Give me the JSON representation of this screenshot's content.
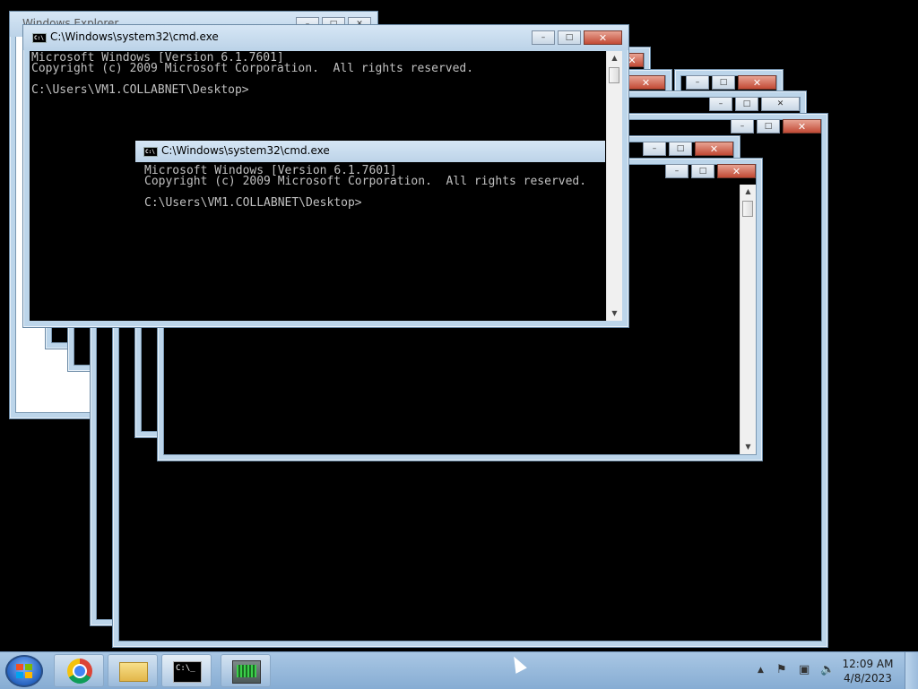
{
  "windows": [
    {
      "title": "Windows Explorer"
    },
    {
      "title": "C:\\Windows\\system32\\cmd.exe"
    },
    {
      "title": "C:\\Windows\\system32\\cmd.exe"
    }
  ],
  "console": {
    "line1": "Microsoft Windows [Version 6.1.7601]",
    "line2": "Copyright (c) 2009 Microsoft Corporation.  All rights reserved.",
    "line3": "",
    "line4": "C:\\Users\\VM1.COLLABNET\\Desktop>"
  },
  "console_front": {
    "line1": "Microsoft Windows [Version 6.1.7601]",
    "line2": "Copyright (c) 2009 Microsoft Corporation.  All rights reserved.",
    "line3": "",
    "line4": "C:\\Users\\VM1.COLLABNET\\Desktop>"
  },
  "partial_text": "Us",
  "window_controls": {
    "minimize": "–",
    "maximize": "□",
    "close": "✕"
  },
  "taskbar": {
    "items": [
      {
        "name": "Google Chrome",
        "icon": "chrome-icon"
      },
      {
        "name": "Windows Explorer",
        "icon": "folder-icon"
      },
      {
        "name": "Command Prompt",
        "icon": "cmd-icon",
        "label": "C:\\_"
      },
      {
        "name": "Network",
        "icon": "network-icon"
      }
    ],
    "tray": {
      "up_arrow": "▲",
      "time": "12:09 AM",
      "date": "4/8/2023"
    }
  },
  "colors": {
    "title_bar": "#bcd5ea",
    "console_bg": "#000000",
    "console_fg": "#c0c0c0",
    "close_button": "#c24a35",
    "taskbar": "#9dbddf"
  }
}
